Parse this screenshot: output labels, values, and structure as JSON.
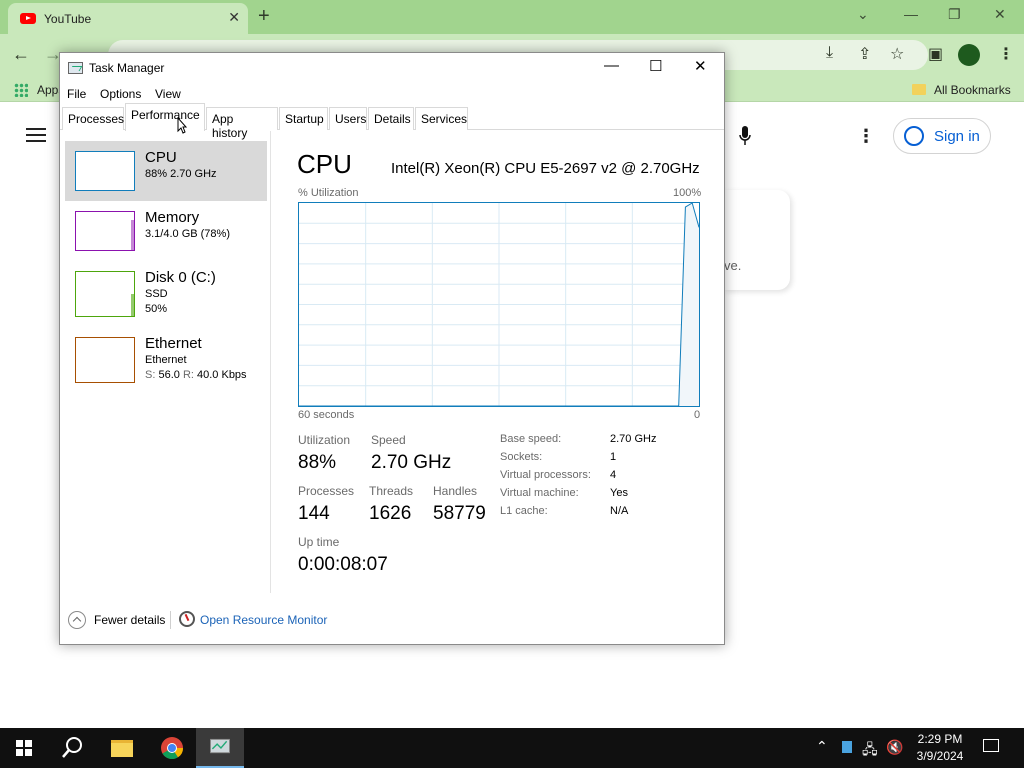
{
  "browser": {
    "tab_title": "YouTube",
    "tab_close": "✕",
    "new_tab": "+",
    "apps_label": "Apps",
    "all_bookmarks": "All Bookmarks"
  },
  "youtube": {
    "sign_in": "Sign in",
    "card_text": "ve."
  },
  "task_manager": {
    "title": "Task Manager",
    "menu": [
      "File",
      "Options",
      "View"
    ],
    "tabs": [
      "Processes",
      "Performance",
      "App history",
      "Startup",
      "Users",
      "Details",
      "Services"
    ],
    "active_tab": "Performance",
    "resources": [
      {
        "name": "CPU",
        "sub1": "88%  2.70 GHz",
        "sub2": "",
        "color": "#117dbb"
      },
      {
        "name": "Memory",
        "sub1": "3.1/4.0 GB (78%)",
        "sub2": "",
        "color": "#8b12ae"
      },
      {
        "name": "Disk 0 (C:)",
        "sub1": "SSD",
        "sub2": "50%",
        "color": "#4da60c"
      },
      {
        "name": "Ethernet",
        "sub1": "Ethernet",
        "sub2_s_label": "S:",
        "sub2_s": "56.0",
        "sub2_r_label": "R:",
        "sub2_r": "40.0 Kbps",
        "color": "#a74f01"
      }
    ],
    "cpu": {
      "title": "CPU",
      "model": "Intel(R) Xeon(R) CPU E5-2697 v2 @ 2.70GHz",
      "util_label": "% Utilization",
      "util_max": "100%",
      "time_label": "60 seconds",
      "time_min": "0",
      "utilization_label": "Utilization",
      "utilization": "88%",
      "speed_label": "Speed",
      "speed": "2.70 GHz",
      "processes_label": "Processes",
      "processes": "144",
      "threads_label": "Threads",
      "threads": "1626",
      "handles_label": "Handles",
      "handles": "58779",
      "uptime_label": "Up time",
      "uptime": "0:00:08:07",
      "specs": [
        {
          "k": "Base speed:",
          "v": "2.70 GHz"
        },
        {
          "k": "Sockets:",
          "v": "1"
        },
        {
          "k": "Virtual processors:",
          "v": "4"
        },
        {
          "k": "Virtual machine:",
          "v": "Yes"
        },
        {
          "k": "L1 cache:",
          "v": "N/A"
        }
      ],
      "graph_utilization_pct": [
        0,
        0,
        0,
        0,
        0,
        0,
        0,
        0,
        0,
        0,
        0,
        0,
        0,
        0,
        0,
        0,
        0,
        0,
        0,
        0,
        0,
        0,
        0,
        0,
        0,
        0,
        0,
        0,
        0,
        0,
        0,
        0,
        0,
        0,
        0,
        0,
        0,
        0,
        0,
        0,
        0,
        0,
        0,
        0,
        0,
        0,
        0,
        0,
        0,
        0,
        0,
        0,
        0,
        0,
        0,
        0,
        0,
        98,
        100,
        88
      ]
    },
    "footer": {
      "fewer_details": "Fewer details",
      "open_resource_monitor": "Open Resource Monitor"
    }
  },
  "taskbar": {
    "time": "2:29 PM",
    "date": "3/9/2024"
  }
}
